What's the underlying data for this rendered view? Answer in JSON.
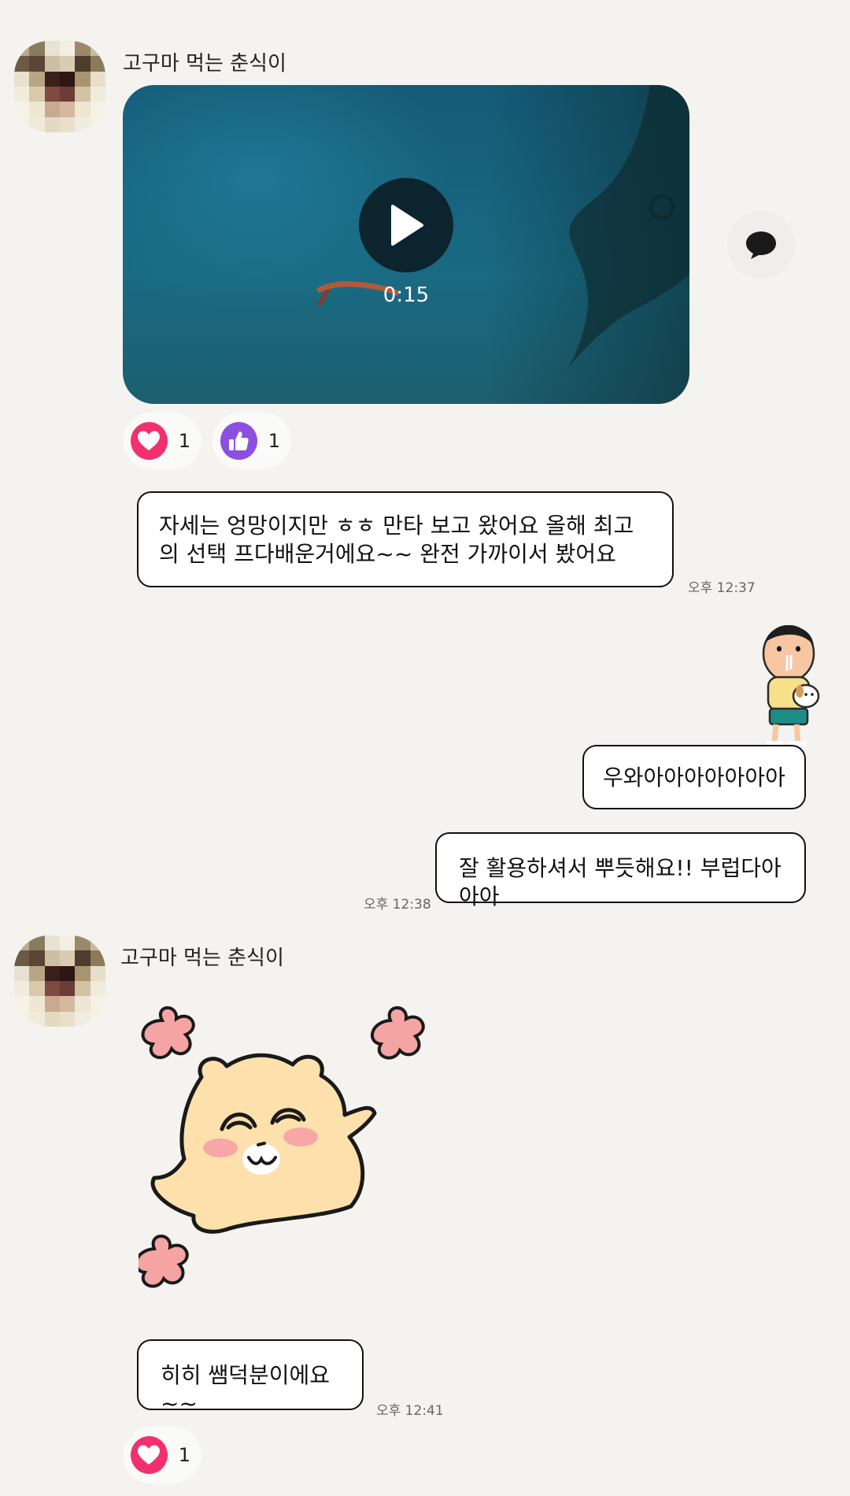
{
  "messages": {
    "group1": {
      "sender": "고구마 먹는 춘식이",
      "video": {
        "duration": "0:15"
      },
      "reactions": [
        {
          "icon": "heart-icon",
          "count": "1",
          "color": "#f2306f"
        },
        {
          "icon": "thumbs-up-icon",
          "count": "1",
          "color": "#8c4fe0"
        }
      ],
      "text": "자세는 엉망이지만 ㅎㅎ 만타 보고 왔어요 올해 최고의 선택 프다배운거에요~~ 완전 가까이서 봤어요",
      "time": "오후 12:37"
    },
    "group2": {
      "bubbles": [
        "우와아아아아아아아",
        "잘 활용하셔서 뿌듯해요!! 부럽다아아아"
      ],
      "time": "오후 12:38"
    },
    "group3": {
      "sender": "고구마 먹는 춘식이",
      "text": "히히 쌤덕분이에요~~",
      "time": "오후 12:41",
      "reactions": [
        {
          "icon": "heart-icon",
          "count": "1",
          "color": "#f2306f"
        }
      ]
    }
  }
}
